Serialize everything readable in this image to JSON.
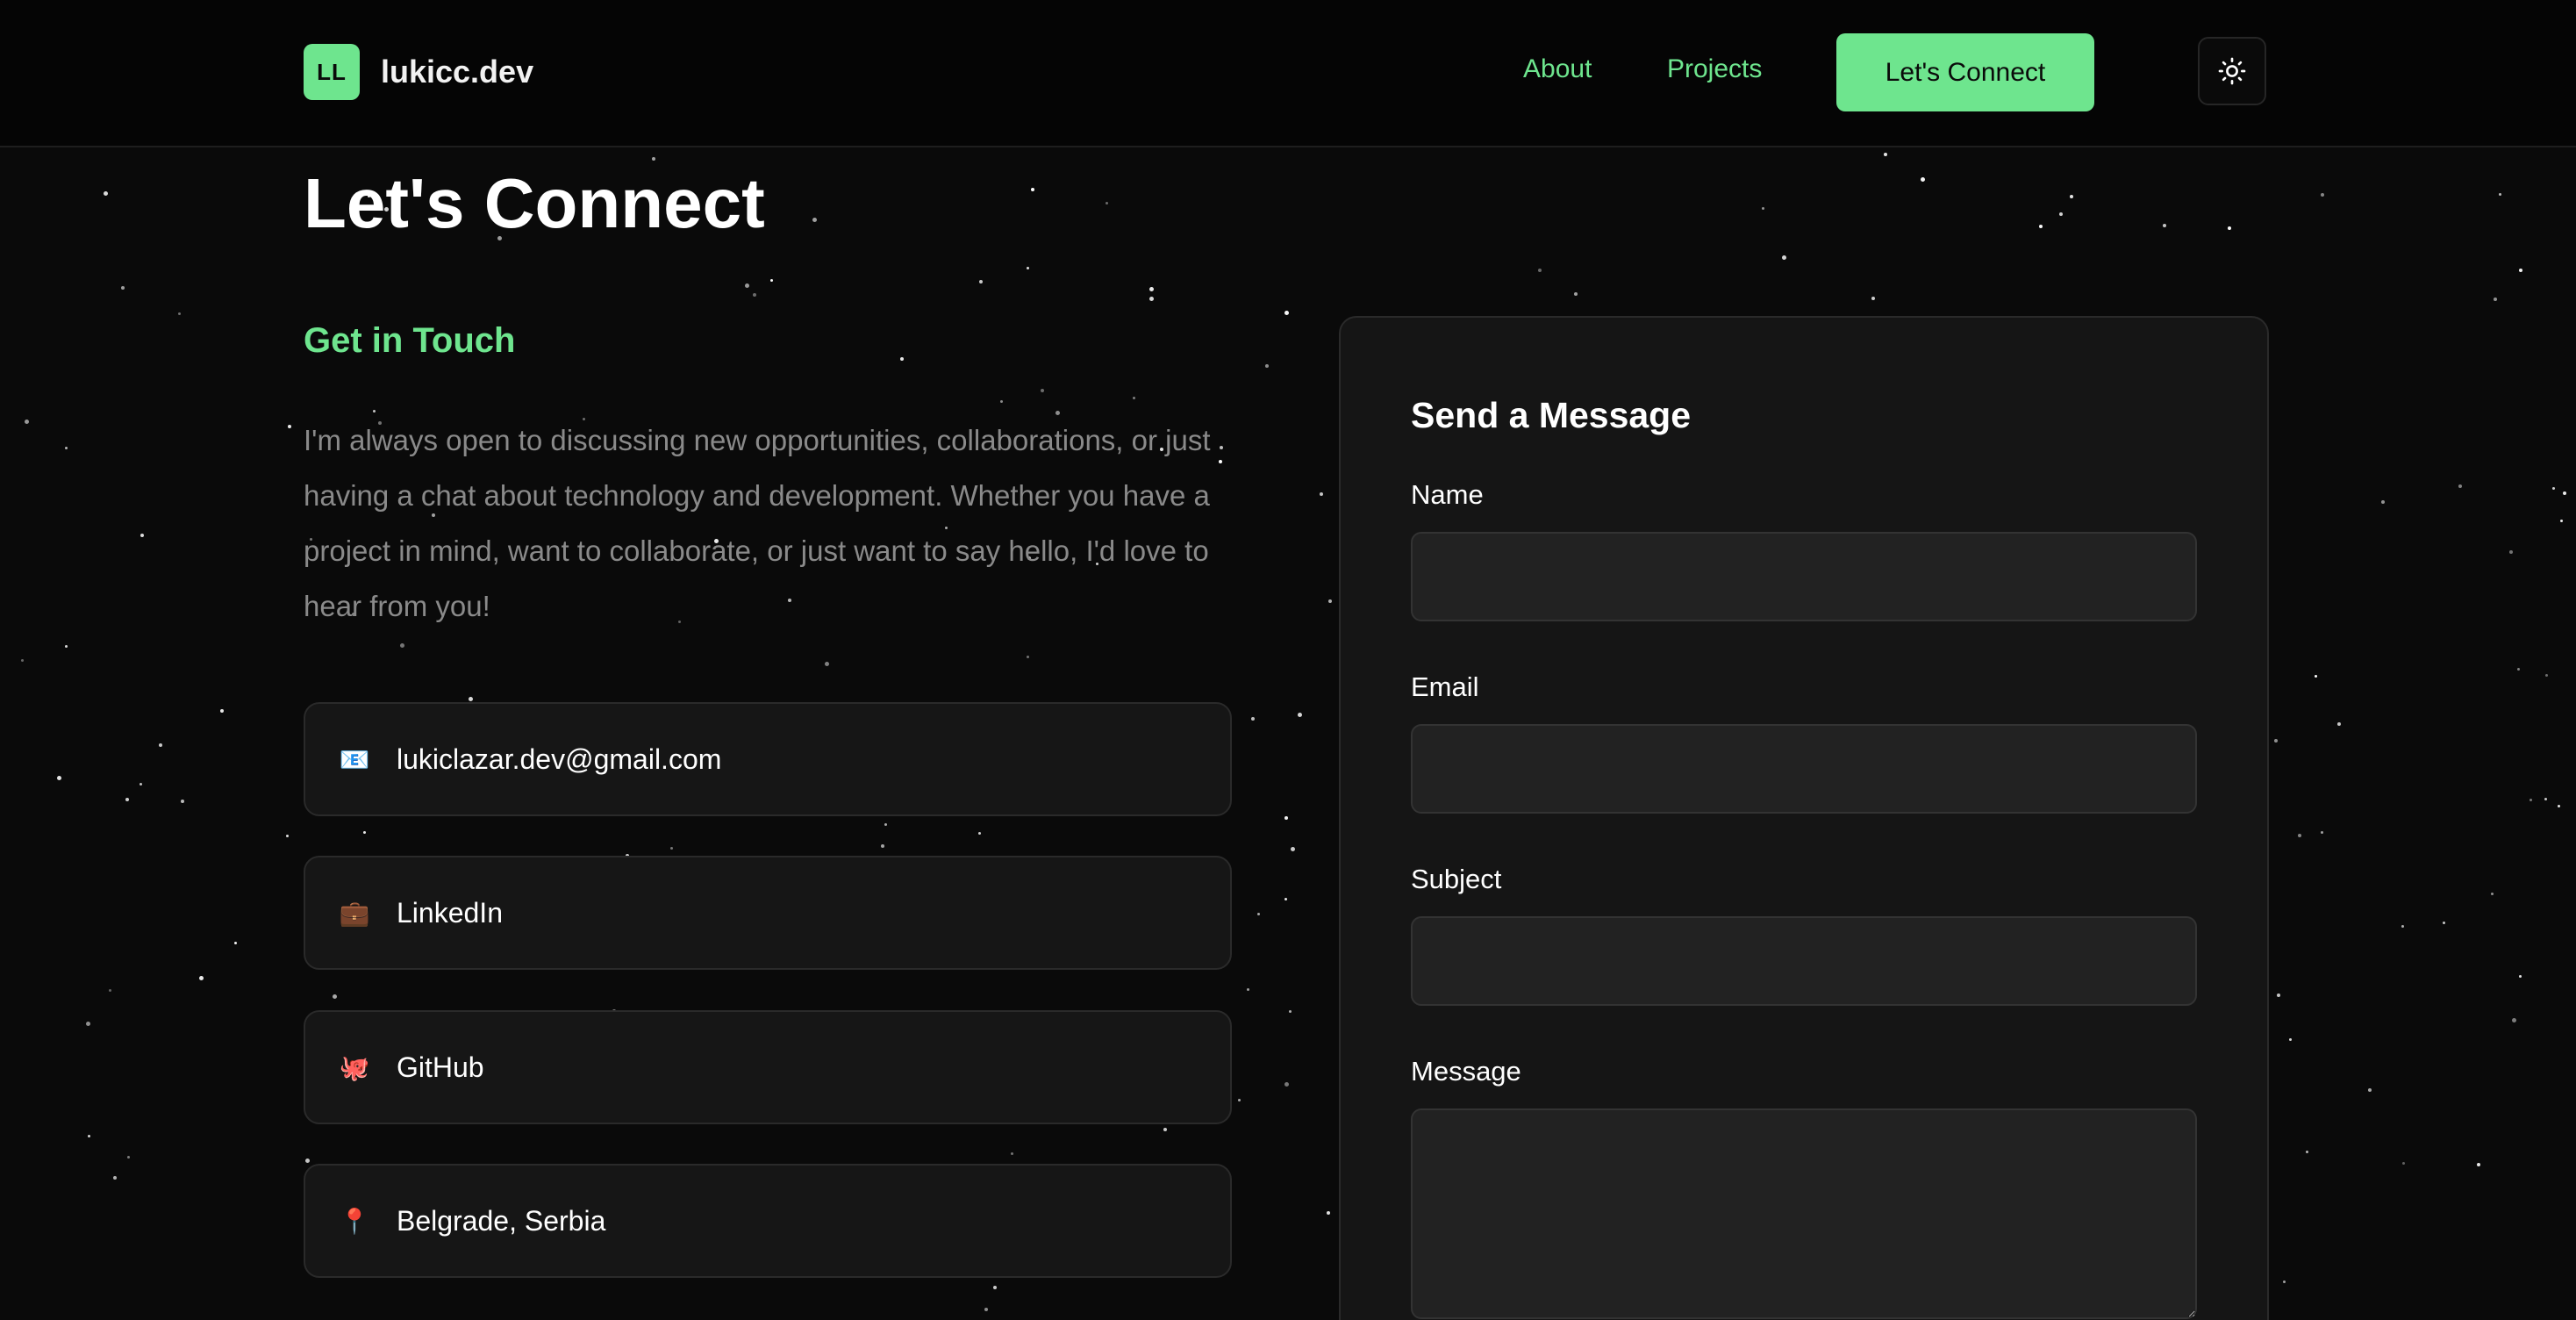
{
  "header": {
    "logo_badge": "LL",
    "logo_text": "lukicc.dev",
    "nav": {
      "about": "About",
      "projects": "Projects"
    },
    "cta_label": "Let's Connect",
    "theme_toggle_icon": "sun-icon"
  },
  "main": {
    "title": "Let's Connect",
    "section_heading": "Get in Touch",
    "intro": "I'm always open to discussing new opportunities, collaborations, or just having a chat about technology and development. Whether you have a project in mind, want to collaborate, or just want to say hello, I'd love to hear from you!",
    "contacts": [
      {
        "icon": "email-icon",
        "glyph": "📧",
        "label": "lukiclazar.dev@gmail.com"
      },
      {
        "icon": "briefcase-icon",
        "glyph": "💼",
        "label": "LinkedIn"
      },
      {
        "icon": "octopus-icon",
        "glyph": "🐙",
        "label": "GitHub"
      },
      {
        "icon": "location-pin-icon",
        "glyph": "📍",
        "label": "Belgrade, Serbia"
      }
    ]
  },
  "form": {
    "title": "Send a Message",
    "fields": {
      "name": {
        "label": "Name",
        "value": ""
      },
      "email": {
        "label": "Email",
        "value": ""
      },
      "subject": {
        "label": "Subject",
        "value": ""
      },
      "message": {
        "label": "Message",
        "value": ""
      }
    }
  },
  "colors": {
    "accent": "#6ee58e",
    "background": "#0a0a0a",
    "card": "#161616",
    "muted_text": "#8a8a8a"
  }
}
